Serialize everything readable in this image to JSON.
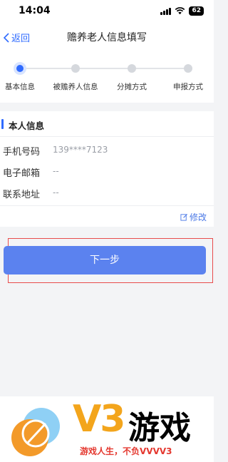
{
  "status": {
    "time": "14:04",
    "battery": "62"
  },
  "nav": {
    "back_label": "返回",
    "title": "赡养老人信息填写"
  },
  "steps": [
    {
      "label": "基本信息",
      "active": true
    },
    {
      "label": "被赡养人信息",
      "active": false
    },
    {
      "label": "分摊方式",
      "active": false
    },
    {
      "label": "申报方式",
      "active": false
    }
  ],
  "section": {
    "title": "本人信息"
  },
  "fields": [
    {
      "label": "手机号码",
      "value": "139****7123"
    },
    {
      "label": "电子邮箱",
      "value": "--"
    },
    {
      "label": "联系地址",
      "value": "--"
    }
  ],
  "edit_label": "修改",
  "next_label": "下一步",
  "watermark": {
    "brand": "V3",
    "name": "游戏",
    "slogan": "游戏人生，不负VVVV3"
  },
  "colors": {
    "accent": "#2f6bff",
    "button": "#5b82ef",
    "highlight_frame": "#e84c4c"
  }
}
